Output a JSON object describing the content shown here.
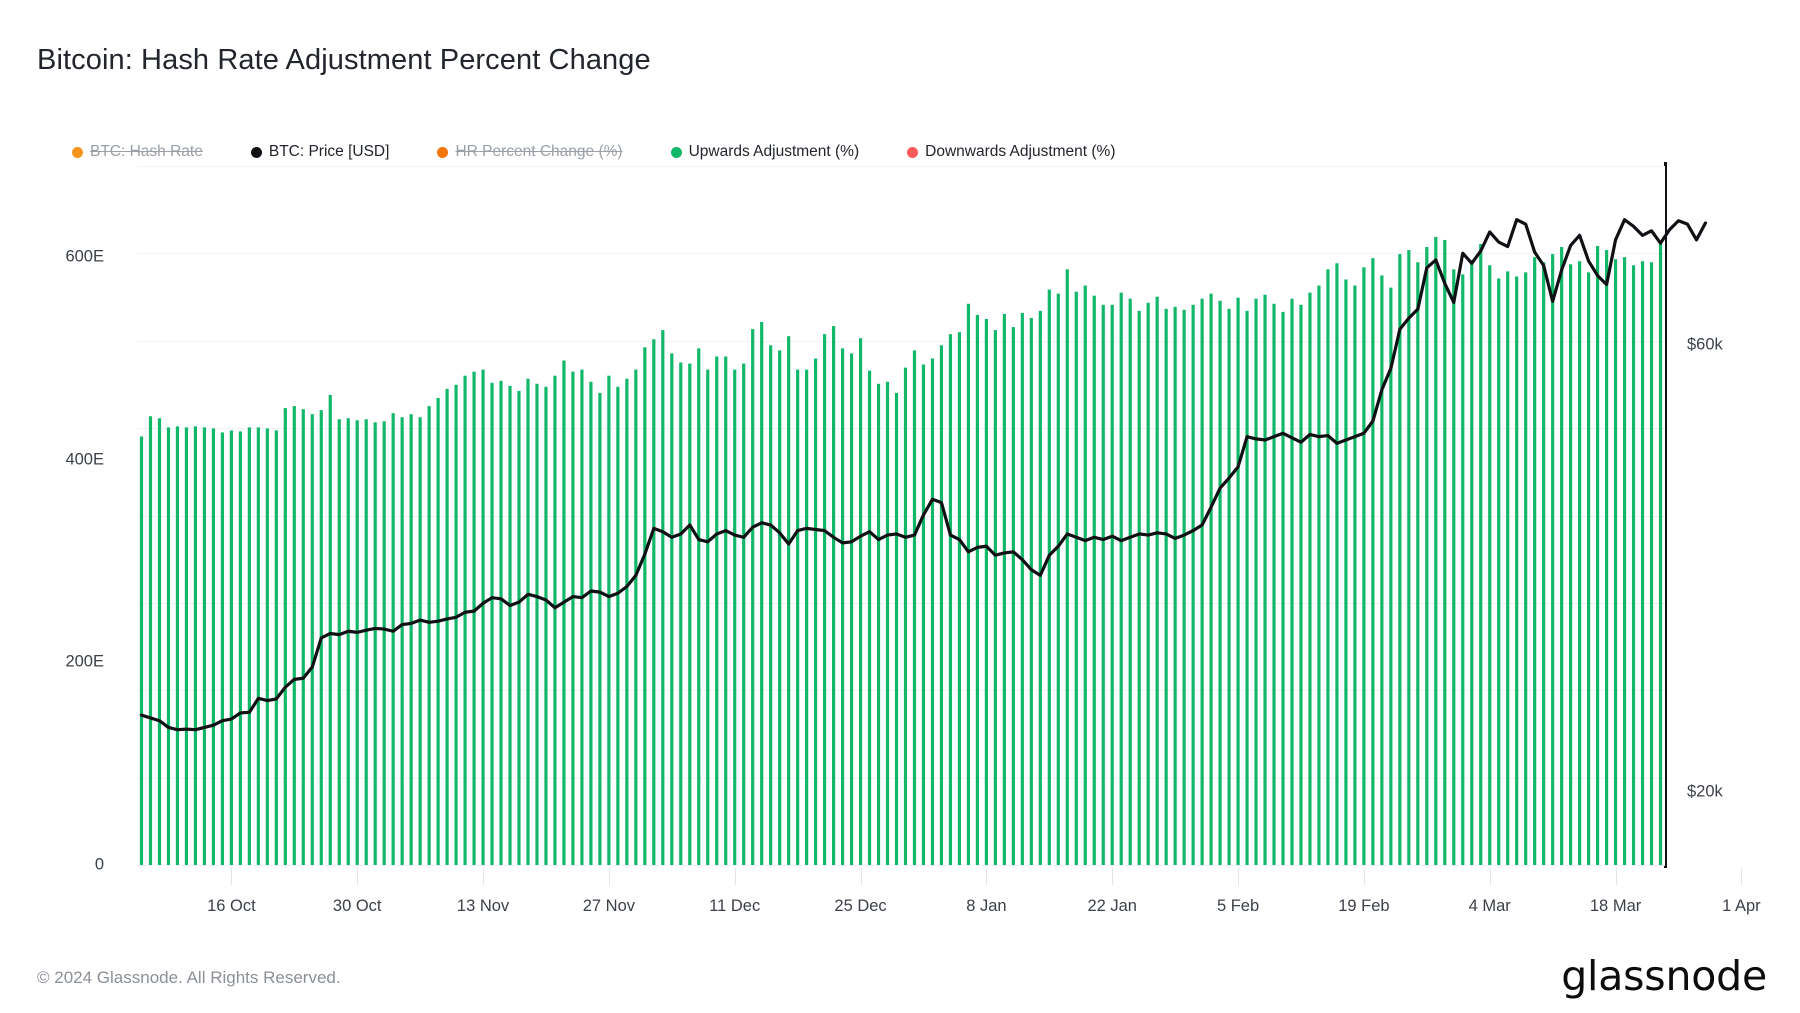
{
  "title": "Bitcoin: Hash Rate Adjustment Percent Change",
  "footer": {
    "copyright": "© 2024 Glassnode. All Rights Reserved.",
    "brand": "glassnode"
  },
  "legend": [
    {
      "label": "BTC: Hash Rate",
      "color": "#F5951E",
      "enabled": false
    },
    {
      "label": "BTC: Price [USD]",
      "color": "#101114",
      "enabled": true
    },
    {
      "label": "HR Percent Change (%)",
      "color": "#F5760B",
      "enabled": false
    },
    {
      "label": "Upwards Adjustment (%)",
      "color": "#12B76A",
      "enabled": true
    },
    {
      "label": "Downwards Adjustment (%)",
      "color": "#FB5A5A",
      "enabled": true
    }
  ],
  "chart_data": {
    "type": "bar",
    "title": "Bitcoin: Hash Rate Adjustment Percent Change",
    "subtitle": "",
    "xlabel": "",
    "ylabel": "",
    "grid": true,
    "legend_position": "top-left",
    "axes": {
      "left": {
        "name": "Hash Rate",
        "unit": "E",
        "ticks": [
          "0",
          "200E",
          "400E",
          "600E"
        ],
        "tick_values": [
          0,
          200,
          400,
          600
        ],
        "range": [
          0,
          690
        ]
      },
      "right": {
        "name": "BTC Price",
        "unit": "USD",
        "ticks": [
          "$20k",
          "$60k"
        ],
        "tick_values": [
          20000,
          60000
        ],
        "range": [
          13500,
          76000
        ]
      },
      "x": {
        "tick_labels": [
          "16 Oct",
          "30 Oct",
          "13 Nov",
          "27 Nov",
          "11 Dec",
          "25 Dec",
          "8 Jan",
          "22 Jan",
          "5 Feb",
          "19 Feb",
          "4 Mar",
          "18 Mar",
          "1 Apr"
        ],
        "tick_index": [
          10,
          24,
          38,
          52,
          66,
          80,
          94,
          108,
          122,
          136,
          150,
          164,
          178
        ],
        "interval_days": 14,
        "range_start": "6 Oct",
        "range_end": "8 Apr"
      }
    },
    "series": [
      {
        "name": "Upwards Adjustment (%)",
        "type": "bar",
        "color": "#12B76A",
        "axis": "left",
        "values": [
          423,
          443,
          441,
          432,
          433,
          432,
          433,
          432,
          431,
          427,
          429,
          428,
          432,
          432,
          431,
          429,
          451,
          453,
          450,
          445,
          449,
          464,
          440,
          441,
          439,
          440,
          437,
          438,
          446,
          442,
          445,
          442,
          453,
          461,
          470,
          474,
          483,
          487,
          489,
          476,
          478,
          473,
          468,
          480,
          475,
          472,
          483,
          498,
          487,
          489,
          477,
          466,
          483,
          472,
          480,
          489,
          511,
          519,
          528,
          505,
          496,
          495,
          510,
          489,
          502,
          502,
          489,
          495,
          529,
          536,
          513,
          508,
          522,
          489,
          489,
          500,
          524,
          532,
          510,
          505,
          520,
          488,
          475,
          477,
          466,
          491,
          508,
          494,
          500,
          513,
          524,
          526,
          554,
          543,
          539,
          528,
          544,
          531,
          545,
          540,
          547,
          568,
          564,
          588,
          566,
          572,
          562,
          553,
          553,
          565,
          559,
          547,
          555,
          561,
          549,
          551,
          548,
          553,
          559,
          564,
          557,
          549,
          560,
          547,
          559,
          563,
          554,
          546,
          559,
          553,
          565,
          572,
          588,
          594,
          578,
          572,
          590,
          599,
          582,
          570,
          603,
          607,
          595,
          610,
          620,
          617,
          588,
          583,
          597,
          613,
          592,
          579,
          586,
          581,
          585,
          600,
          595,
          603,
          610,
          593,
          596,
          585,
          611,
          607,
          598,
          600,
          592,
          596,
          595,
          613
        ]
      },
      {
        "name": "Downwards Adjustment (%)",
        "type": "bar",
        "color": "#FB5A5A",
        "axis": "left",
        "values": []
      },
      {
        "name": "BTC: Price [USD]",
        "type": "line",
        "color": "#101114",
        "axis": "right",
        "values": [
          26900,
          26650,
          26400,
          25800,
          25600,
          25650,
          25600,
          25800,
          26000,
          26400,
          26550,
          27100,
          27150,
          28400,
          28200,
          28350,
          29400,
          30100,
          30200,
          31200,
          33800,
          34200,
          34100,
          34400,
          34300,
          34500,
          34650,
          34600,
          34400,
          35000,
          35100,
          35400,
          35200,
          35300,
          35500,
          35650,
          36100,
          36200,
          36900,
          37400,
          37300,
          36700,
          37000,
          37700,
          37500,
          37200,
          36500,
          37000,
          37500,
          37400,
          38000,
          37900,
          37500,
          37800,
          38400,
          39400,
          41300,
          43600,
          43300,
          42800,
          43100,
          43900,
          42600,
          42400,
          43100,
          43400,
          43000,
          42800,
          43700,
          44100,
          43900,
          43200,
          42200,
          43400,
          43600,
          43500,
          43400,
          42800,
          42300,
          42400,
          42900,
          43300,
          42600,
          43000,
          43100,
          42800,
          43000,
          44800,
          46200,
          45900,
          43000,
          42600,
          41500,
          41900,
          42000,
          41200,
          41400,
          41500,
          40800,
          39900,
          39400,
          41200,
          42000,
          43100,
          42800,
          42500,
          42800,
          42600,
          42900,
          42500,
          42800,
          43100,
          43000,
          43200,
          43100,
          42700,
          43000,
          43400,
          43900,
          45500,
          47200,
          48100,
          49100,
          51800,
          51600,
          51500,
          51800,
          52100,
          51700,
          51300,
          52000,
          51800,
          51900,
          51200,
          51500,
          51800,
          52100,
          53200,
          56000,
          57900,
          61400,
          62400,
          63200,
          66900,
          67600,
          65500,
          63800,
          68200,
          67300,
          68400,
          70100,
          69200,
          68800,
          71200,
          70800,
          68300,
          67100,
          63900,
          66700,
          68900,
          69800,
          67500,
          66200,
          65400,
          69400,
          71200,
          70600,
          69800,
          70200,
          69100,
          70300,
          71100,
          70800,
          69400,
          70900
        ]
      }
    ]
  }
}
